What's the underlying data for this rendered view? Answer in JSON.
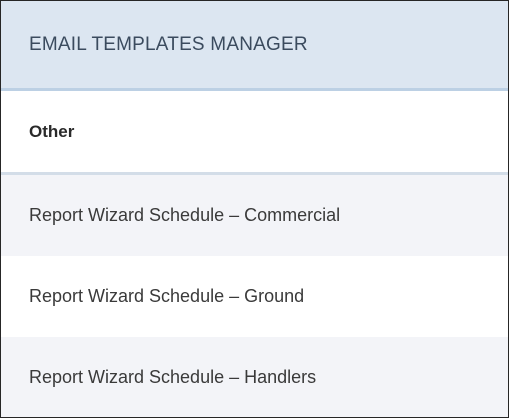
{
  "panel": {
    "title": "EMAIL TEMPLATES MANAGER"
  },
  "group": {
    "label": "Other"
  },
  "templates": [
    {
      "label": "Report Wizard Schedule – Commercial"
    },
    {
      "label": "Report Wizard Schedule – Ground"
    },
    {
      "label": "Report Wizard Schedule – Handlers"
    }
  ],
  "colors": {
    "header_bg": "#dce6f1",
    "header_border": "#bcd0e4",
    "row_alt_bg": "#f3f4f8",
    "panel_border": "#262626"
  }
}
